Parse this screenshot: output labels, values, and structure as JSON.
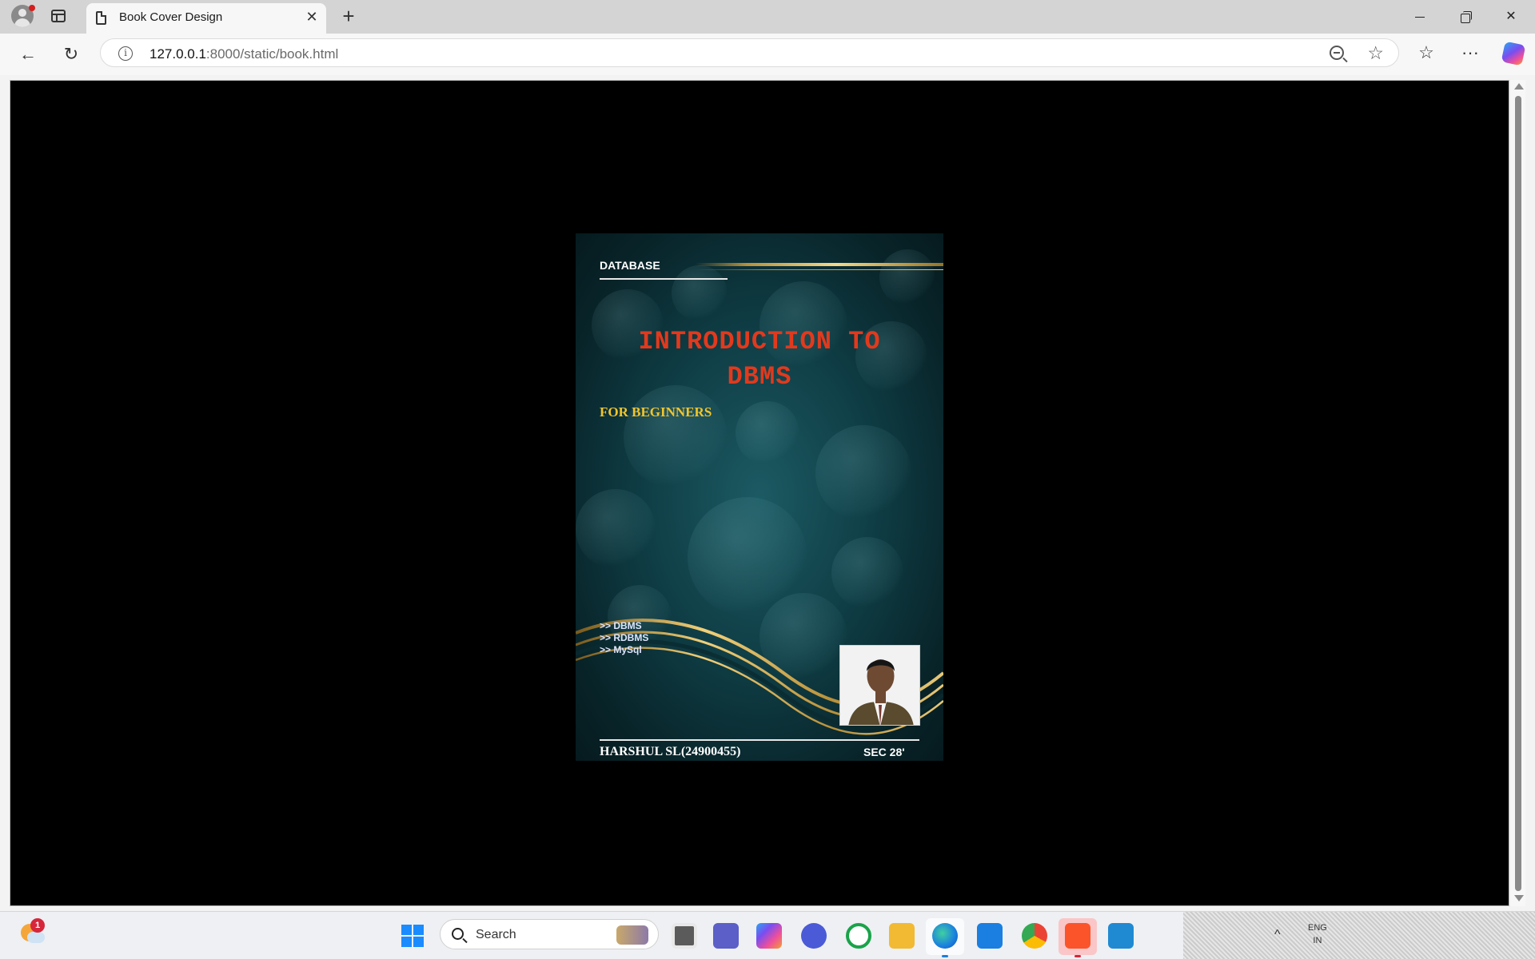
{
  "browser": {
    "tab": {
      "title": "Book Cover Design",
      "close": "✕"
    },
    "new_tab": "+",
    "window_controls": {
      "minimize": "",
      "maximize": "",
      "close": "✕"
    },
    "nav": {
      "back": "←",
      "reload": "↻"
    },
    "address": {
      "host": "127.0.0.1",
      "path": ":8000/static/book.html"
    },
    "toolbar_icons": {
      "favorites": "☆",
      "more": "···"
    },
    "icons": [
      "profile-icon",
      "tab-actions-icon",
      "page-icon",
      "info-icon",
      "zoom-out-icon",
      "star-icon",
      "favorites-icon",
      "more-icon",
      "copilot-icon"
    ]
  },
  "page": {
    "background": "#000000",
    "cover": {
      "category": "DATABASE",
      "title": "INTRODUCTION TO DBMS",
      "subtitle": "FOR BEGINNERS",
      "topics": [
        ">> DBMS",
        ">> RDBMS",
        ">> MySql"
      ],
      "author": "HARSHUL SL(24900455)",
      "section": "SEC 28'",
      "colors": {
        "title": "#e2391d",
        "subtitle": "#f2c52a",
        "accent_gold": "#d8b15a",
        "background": "#0f3d45"
      }
    }
  },
  "taskbar": {
    "weather_badge": "1",
    "search": {
      "label": "Search"
    },
    "language": {
      "line1": "ENG",
      "line2": "IN"
    },
    "tray_up": "^",
    "apps": [
      "start-icon",
      "file-explorer-icon",
      "teams-icon",
      "copilot-app-icon",
      "arc-icon",
      "spotify-like-icon",
      "folder-icon",
      "edge-icon",
      "store-icon",
      "chrome-icon",
      "brave-icon",
      "vscode-icon"
    ]
  }
}
